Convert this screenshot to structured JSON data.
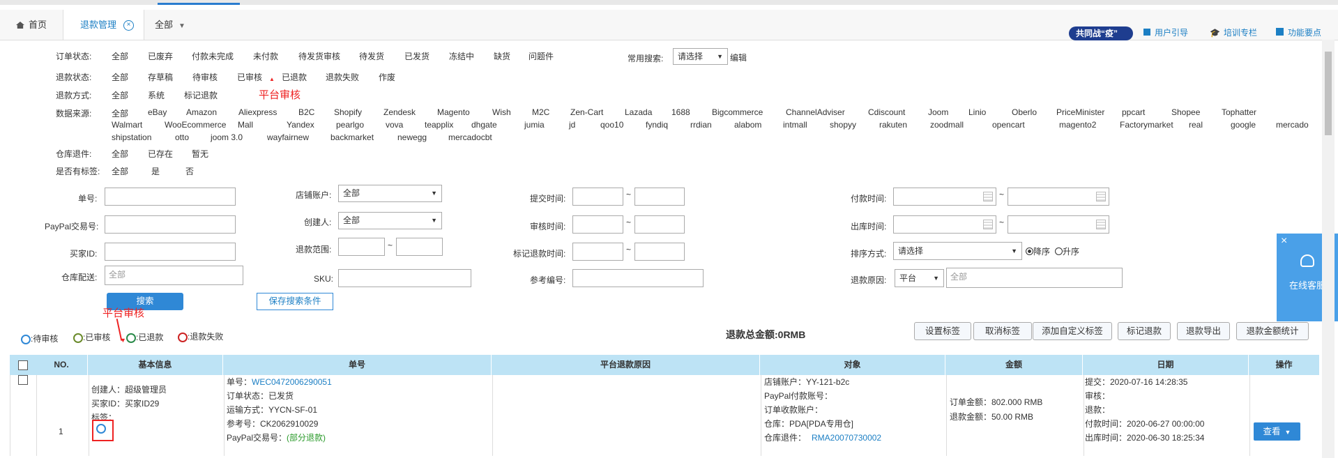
{
  "tabs": {
    "home": "首页",
    "refund_mgmt": "退款管理",
    "scope": "全部"
  },
  "toolbar": {
    "campaign": "共同战“疫”",
    "user_guide": "用户引导",
    "training": "培训专栏",
    "features": "功能要点"
  },
  "filters": {
    "order_status": {
      "label": "订单状态:",
      "options": [
        "全部",
        "已废弃",
        "付款未完成",
        "未付款",
        "待发货审核",
        "待发货",
        "已发货",
        "冻结中",
        "缺货",
        "问题件"
      ]
    },
    "refund_status": {
      "label": "退款状态:",
      "options": [
        "全部",
        "存草稿",
        "待审核",
        "已审核",
        "已退款",
        "退款失败",
        "作废"
      ]
    },
    "refund_method": {
      "label": "退款方式:",
      "options": [
        "全部",
        "系统",
        "标记退款"
      ]
    },
    "data_source": {
      "label": "数据来源:",
      "rows": [
        [
          "全部",
          "eBay",
          "Amazon",
          "Aliexpress",
          "B2C",
          "Shopify",
          "Zendesk",
          "Magento",
          "Wish",
          "M2C",
          "Zen-Cart",
          "Lazada",
          "1688",
          "Bigcommerce",
          "ChannelAdviser",
          "Cdiscount",
          "Joom",
          "Linio",
          "Oberlo",
          "PriceMinister",
          "ppcart",
          "Shopee",
          "Tophatter"
        ],
        [
          "Walmart",
          "WooEcommerce",
          "Mall",
          "Yandex",
          "pearlgo",
          "vova",
          "teapplix",
          "dhgate",
          "jumia",
          "jd",
          "qoo10",
          "fyndiq",
          "rrdian",
          "alabom",
          "intmall",
          "shopyy",
          "rakuten",
          "zoodmall",
          "opencart",
          "magento2",
          "Factorymarket",
          "real",
          "google",
          "mercado"
        ],
        [
          "shipstation",
          "otto",
          "joom 3.0",
          "wayfairnew",
          "backmarket",
          "newegg",
          "mercadocbt"
        ]
      ]
    },
    "warehouse_return": {
      "label": "仓库退件:",
      "options": [
        "全部",
        "已存在",
        "暂无"
      ]
    },
    "has_tag": {
      "label": "是否有标签:",
      "options": [
        "全部",
        "是",
        "否"
      ]
    },
    "common_search": {
      "label": "常用搜索:",
      "value": "请选择",
      "edit": "编辑"
    }
  },
  "annotation": "平台审核",
  "search_form": {
    "order_no": "单号:",
    "paypal_txn": "PayPal交易号:",
    "buyer_id": "买家ID:",
    "warehouse": "仓库配送:",
    "warehouse_placeholder": "全部",
    "shop_account": "店铺账户:",
    "shop_value": "全部",
    "creator": "创建人:",
    "creator_value": "全部",
    "refund_range": "退款范围:",
    "sku": "SKU:",
    "submit_time": "提交时间:",
    "review_time": "审核时间:",
    "mark_refund_time": "标记退款时间:",
    "ref_no": "参考编号:",
    "pay_time": "付款时间:",
    "ship_time": "出库时间:",
    "sort_method": "排序方式:",
    "sort_value": "请选择",
    "sort_desc": "降序",
    "sort_asc": "升序",
    "refund_reason": "退款原因:",
    "reason_platform": "平台",
    "reason_all": "全部",
    "tilde": "~",
    "search_btn": "搜索",
    "save_search_btn": "保存搜索条件"
  },
  "legend": {
    "pending": ":待审核",
    "reviewed": ":已审核",
    "refunded": ":已退款",
    "failed": ":退款失败"
  },
  "total": "退款总金额:0RMB",
  "actions": [
    "设置标签",
    "取消标签",
    "添加自定义标签",
    "标记退款",
    "退款导出",
    "退款金额统计"
  ],
  "table": {
    "headers": [
      "NO.",
      "基本信息",
      "单号",
      "平台退款原因",
      "对象",
      "金额",
      "日期",
      "操作"
    ],
    "row": {
      "no": "1",
      "creator": "创建人：超级管理员",
      "buyer": "买家ID：买家ID29",
      "tag": "标签：",
      "order_label": "单号：",
      "order_no": "WEC0472006290051",
      "order_status": "订单状态：已发货",
      "ship_method": "运输方式：YYCN-SF-01",
      "ref_no": "参考号：CK2062910029",
      "paypal_label": "PayPal交易号：",
      "paypal_value": "(部分退款)",
      "shop": "店铺账户：YY-121-b2c",
      "paypal_pay_account": "PayPal付款账号：",
      "order_receive_account": "订单收款账户：",
      "warehouse": "仓库：PDA[PDA专用仓]",
      "return_label": "仓库退件：",
      "return_no": "RMA20070730002",
      "order_amount": "订单金额：802.000 RMB",
      "refund_amount": "退款金额：50.00 RMB",
      "submit": "提交：2020-07-16 14:28:35",
      "review": "审核：",
      "refund": "退款：",
      "pay_time": "付款时间：2020-06-27 00:00:00",
      "ship_time": "出库时间：2020-06-30 18:25:34",
      "view_btn": "查看"
    }
  },
  "side_panel": {
    "label": "在线客服",
    "close": "×"
  },
  "colors": {
    "accent": "#2f88d6",
    "header_bg": "#bde3f5",
    "annotation": "#e22222"
  }
}
